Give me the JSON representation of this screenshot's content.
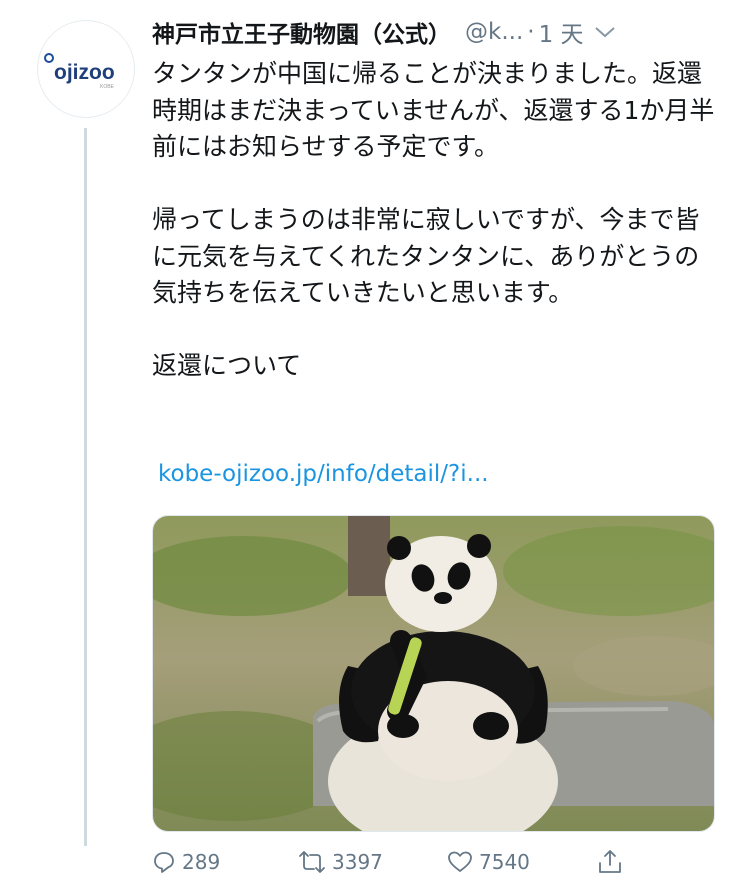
{
  "author": {
    "display_name": "神戸市立王子動物園（公式）",
    "handle": "@k...",
    "separator": "·",
    "time": "1 天",
    "avatar_logo": "ojizoo",
    "avatar_subtext": "KOBE"
  },
  "tweet": {
    "paragraphs": [
      "タンタンが中国に帰ることが決まりました。返還時期はまだ決まっていませんが、返還する1か月半前にはお知らせする予定です。",
      "帰ってしまうのは非常に寂しいですが、今まで皆に元気を与えてくれたタンタンに、ありがとうの気持ちを伝えていきたいと思います。",
      "返還について"
    ],
    "link_text": "kobe-ojizoo.jp/info/detail/?i..."
  },
  "actions": {
    "reply_count": "289",
    "retweet_count": "3397",
    "like_count": "7540"
  },
  "icons": {
    "more": "chevron-down-icon",
    "reply": "reply-icon",
    "retweet": "retweet-icon",
    "like": "heart-icon",
    "share": "share-icon"
  },
  "colors": {
    "link": "#1b95e0",
    "secondary_text": "#657786",
    "thread_line": "#cfd9de"
  }
}
